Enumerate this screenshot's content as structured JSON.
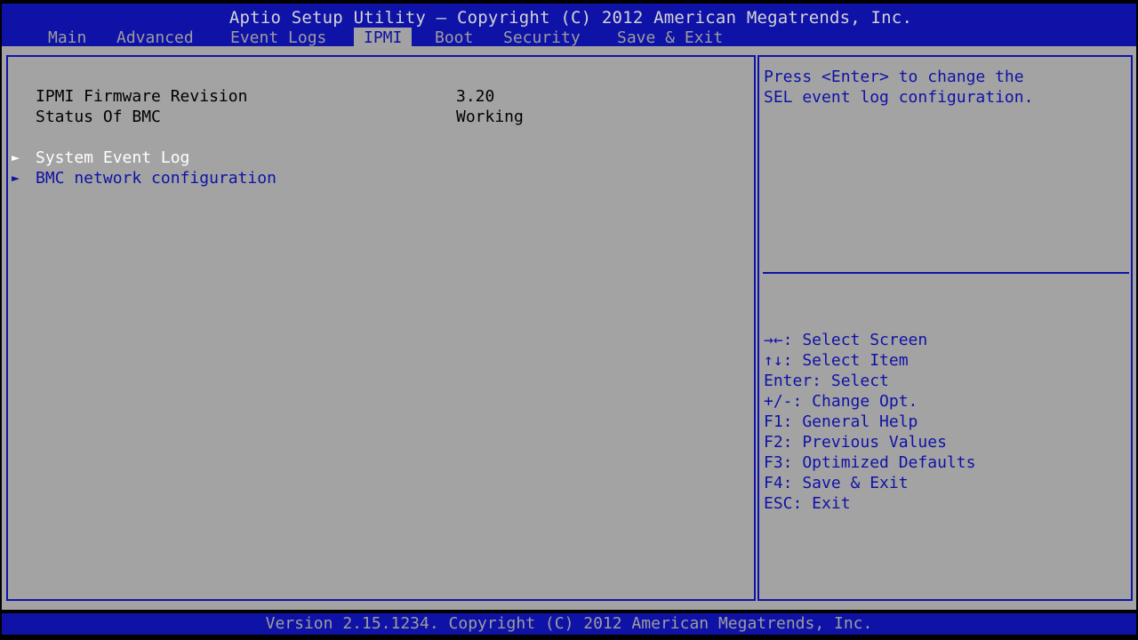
{
  "header": {
    "title": "Aptio Setup Utility – Copyright (C) 2012 American Megatrends, Inc.",
    "tabs": [
      {
        "label": "Main",
        "active": false
      },
      {
        "label": "Advanced",
        "active": false
      },
      {
        "label": "Event Logs",
        "active": false
      },
      {
        "label": "IPMI",
        "active": true
      },
      {
        "label": "Boot",
        "active": false
      },
      {
        "label": "Security",
        "active": false
      },
      {
        "label": "Save & Exit",
        "active": false
      }
    ]
  },
  "main": {
    "info_rows": [
      {
        "label": "IPMI Firmware Revision",
        "value": "3.20"
      },
      {
        "label": "Status Of BMC",
        "value": "Working"
      }
    ],
    "menu_items": [
      {
        "label": "System Event Log",
        "selected": true
      },
      {
        "label": "BMC network configuration",
        "selected": false
      }
    ],
    "submenu_arrow": "►"
  },
  "help": {
    "lines": [
      "Press <Enter> to change the",
      "SEL event log configuration."
    ]
  },
  "keys": {
    "lines": [
      "→←: Select Screen",
      "↑↓: Select Item",
      "Enter: Select",
      "+/-: Change Opt.",
      "F1: General Help",
      "F2: Previous Values",
      "F3: Optimized Defaults",
      "F4: Save & Exit",
      "ESC: Exit"
    ]
  },
  "footer": {
    "text": "Version 2.15.1234. Copyright (C) 2012 American Megatrends, Inc."
  },
  "colors": {
    "header_blue": "#0f12a6",
    "panel_gray": "#a3a3a3",
    "highlight_white": "#ffffff"
  }
}
